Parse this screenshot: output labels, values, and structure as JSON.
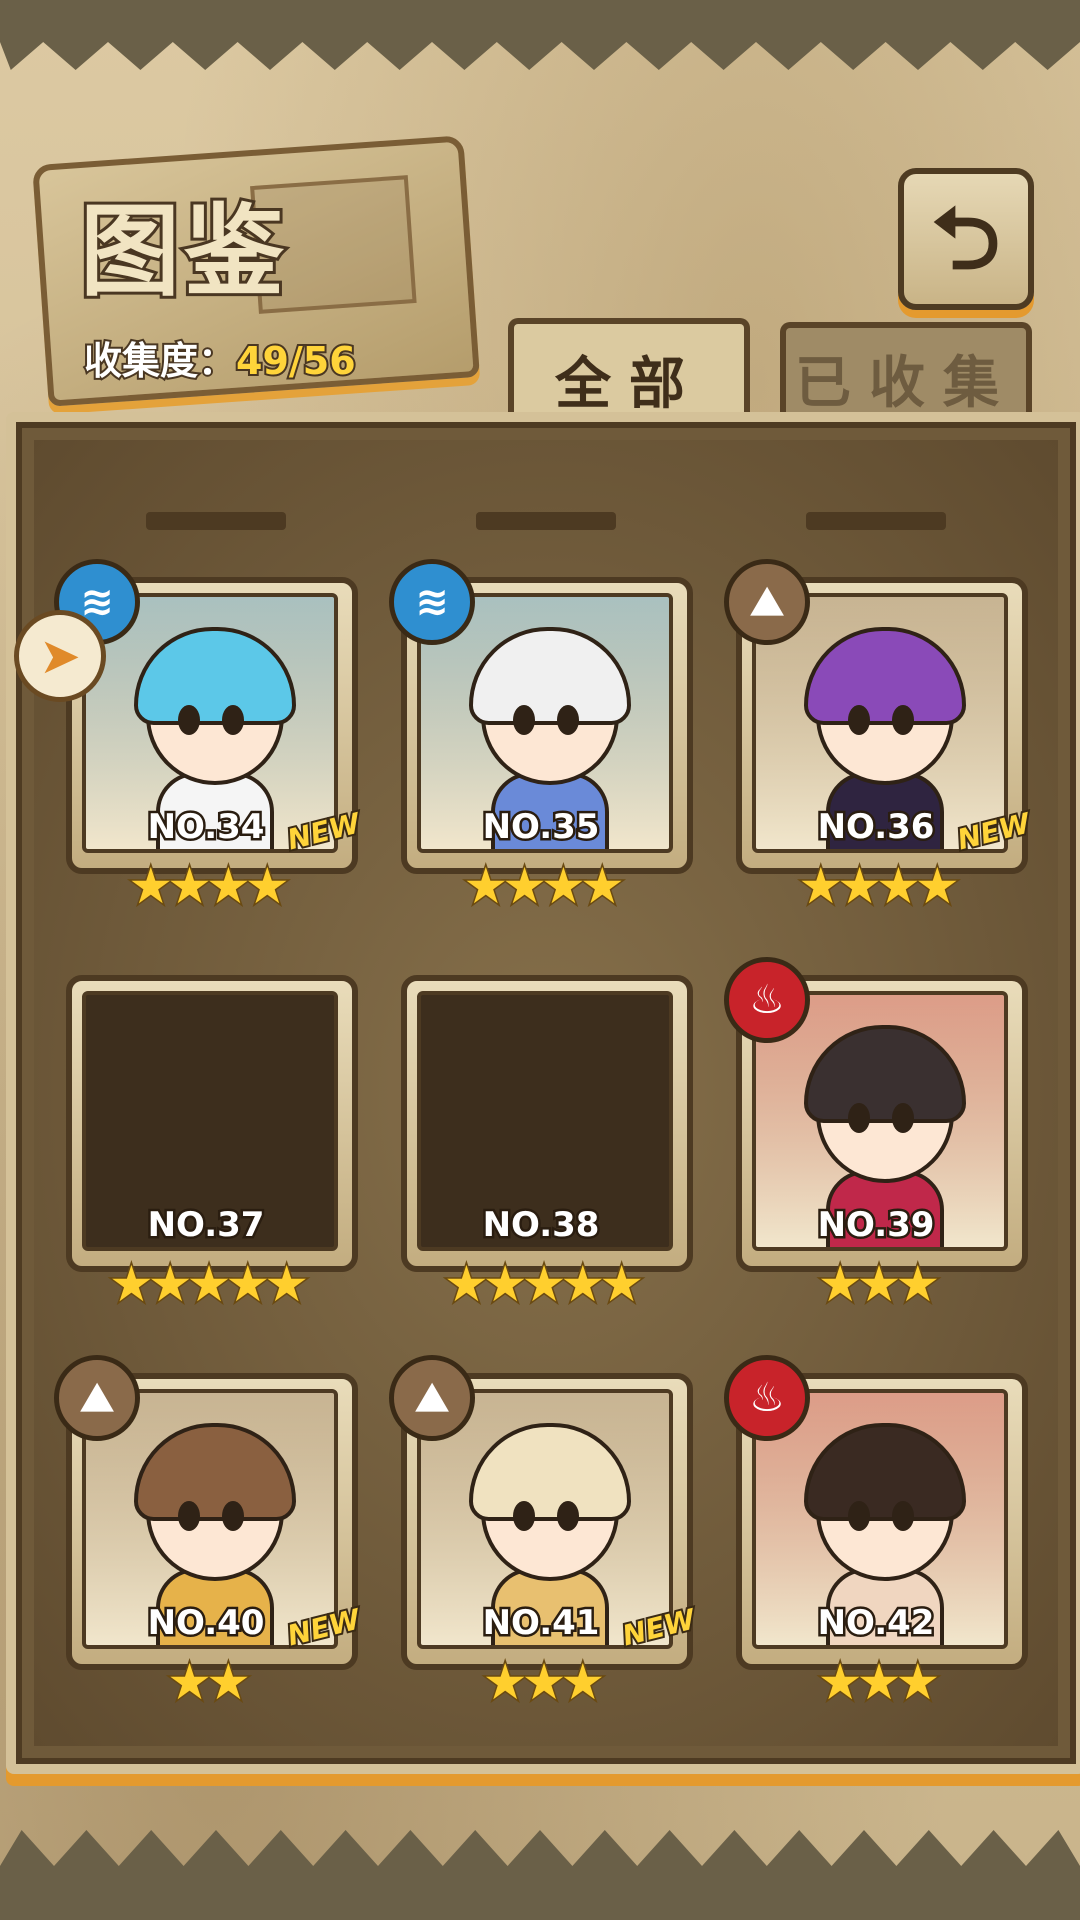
{
  "header": {
    "title": "图鉴",
    "collection_label": "收集度：",
    "collection_value": "49/56",
    "back_icon": "return-icon"
  },
  "tabs": [
    {
      "label": "全部",
      "active": true
    },
    {
      "label": "已收集",
      "active": false
    }
  ],
  "side_button_icon": "arrow-filter-icon",
  "cards": [
    {
      "no": "NO.34",
      "element": "water",
      "new": "NEW",
      "stars": "★★★★",
      "locked": false,
      "hair": "#5cc8e8",
      "body": "#f5f5f5"
    },
    {
      "no": "NO.35",
      "element": "water",
      "new": "",
      "stars": "★★★★",
      "locked": false,
      "hair": "#f0f0f0",
      "body": "#6a8ad8"
    },
    {
      "no": "NO.36",
      "element": "earth",
      "new": "NEW",
      "stars": "★★★★",
      "locked": false,
      "hair": "#8a4ab8",
      "body": "#2f2440"
    },
    {
      "no": "NO.37",
      "element": "",
      "new": "",
      "stars": "★★★★★",
      "locked": true,
      "hair": "",
      "body": ""
    },
    {
      "no": "NO.38",
      "element": "",
      "new": "",
      "stars": "★★★★★",
      "locked": true,
      "hair": "",
      "body": ""
    },
    {
      "no": "NO.39",
      "element": "fire",
      "new": "",
      "stars": "★★★",
      "locked": false,
      "hair": "#3a3030",
      "body": "#c0284a"
    },
    {
      "no": "NO.40",
      "element": "earth",
      "new": "NEW",
      "stars": "★★",
      "locked": false,
      "hair": "#8a6040",
      "body": "#e6b24a"
    },
    {
      "no": "NO.41",
      "element": "earth",
      "new": "NEW",
      "stars": "★★★",
      "locked": false,
      "hair": "#f0e2c0",
      "body": "#e8c070"
    },
    {
      "no": "NO.42",
      "element": "fire",
      "new": "",
      "stars": "★★★",
      "locked": false,
      "hair": "#3a2a22",
      "body": "#f0d6c0"
    }
  ],
  "colors": {
    "water": "#2f8fd0",
    "earth": "#8a6a4a",
    "fire": "#c8232a",
    "accent": "#e49a2e"
  }
}
